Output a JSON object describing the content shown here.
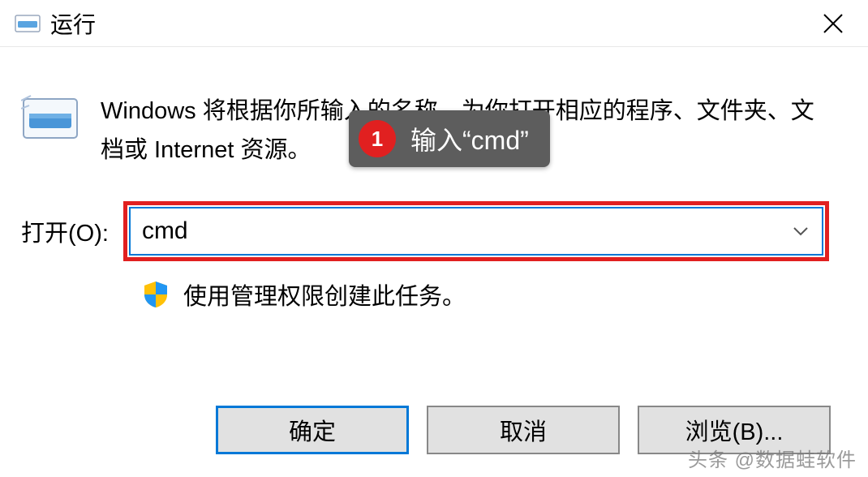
{
  "titlebar": {
    "title": "运行"
  },
  "description": "Windows 将根据你所输入的名称，为你打开相应的程序、文件夹、文档或 Internet 资源。",
  "input": {
    "label": "打开(O):",
    "value": "cmd"
  },
  "admin_note": "使用管理权限创建此任务。",
  "buttons": {
    "ok": "确定",
    "cancel": "取消",
    "browse": "浏览(B)..."
  },
  "callout": {
    "number": "1",
    "text": "输入“cmd”"
  },
  "watermark": "头条 @数据蛙软件"
}
